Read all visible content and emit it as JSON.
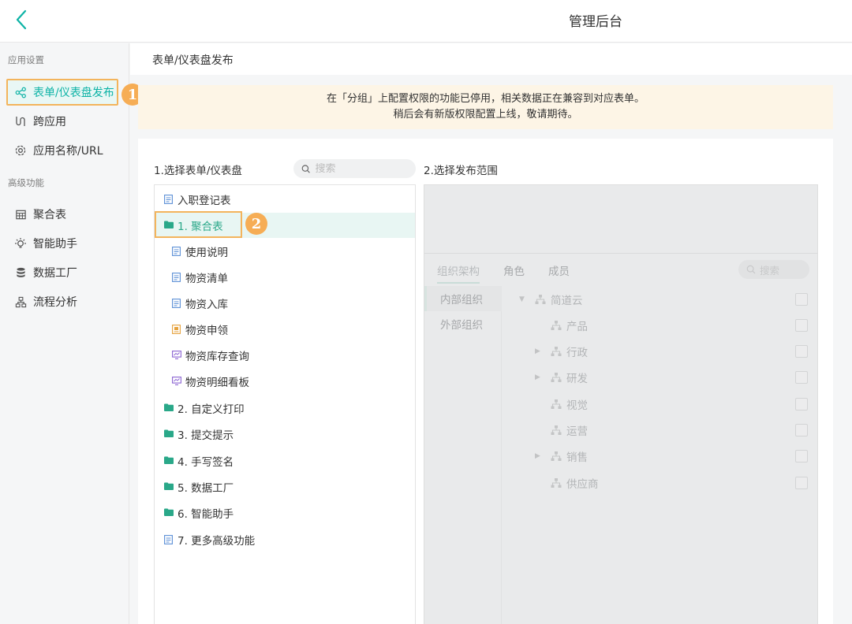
{
  "header": {
    "title": "管理后台",
    "back_icon": "chevron-left-icon"
  },
  "sidebar": {
    "sections": [
      {
        "label": "应用设置"
      },
      {
        "label": "高级功能"
      }
    ],
    "items": [
      {
        "label": "表单/仪表盘发布",
        "icon": "share-icon",
        "active": true
      },
      {
        "label": "跨应用",
        "icon": "link-icon"
      },
      {
        "label": "应用名称/URL",
        "icon": "gear-icon"
      },
      {
        "label": "聚合表",
        "icon": "table-icon"
      },
      {
        "label": "智能助手",
        "icon": "bulb-icon"
      },
      {
        "label": "数据工厂",
        "icon": "database-icon"
      },
      {
        "label": "流程分析",
        "icon": "flow-icon"
      }
    ]
  },
  "annotations": {
    "badge1": "1",
    "badge2": "2"
  },
  "main": {
    "title": "表单/仪表盘发布",
    "notice": {
      "line1": "在「分组」上配置权限的功能已停用，相关数据正在兼容到对应表单。",
      "line2": "稍后会有新版权限配置上线，敬请期待。"
    },
    "left": {
      "title": "1.选择表单/仪表盘",
      "search_placeholder": "搜索",
      "tree": [
        {
          "label": "入职登记表",
          "type": "form",
          "level": 0
        },
        {
          "label": "1. 聚合表",
          "type": "folder",
          "level": 0,
          "selected": true
        },
        {
          "label": "使用说明",
          "type": "form",
          "level": 1
        },
        {
          "label": "物资清单",
          "type": "form",
          "level": 1
        },
        {
          "label": "物资入库",
          "type": "form",
          "level": 1
        },
        {
          "label": "物资申领",
          "type": "flow",
          "level": 1
        },
        {
          "label": "物资库存查询",
          "type": "dashboard",
          "level": 1
        },
        {
          "label": "物资明细看板",
          "type": "dashboard",
          "level": 1
        },
        {
          "label": "2. 自定义打印",
          "type": "folder",
          "level": 0
        },
        {
          "label": "3. 提交提示",
          "type": "folder",
          "level": 0
        },
        {
          "label": "4. 手写签名",
          "type": "folder",
          "level": 0
        },
        {
          "label": "5. 数据工厂",
          "type": "folder",
          "level": 0
        },
        {
          "label": "6. 智能助手",
          "type": "folder",
          "level": 0
        },
        {
          "label": "7. 更多高级功能",
          "type": "form",
          "level": 0
        }
      ]
    },
    "right": {
      "title": "2.选择发布范围",
      "tabs": [
        {
          "label": "组织架构",
          "active": true
        },
        {
          "label": "角色"
        },
        {
          "label": "成员"
        }
      ],
      "search_placeholder": "搜索",
      "left_items": [
        {
          "label": "内部组织",
          "active": true
        },
        {
          "label": "外部组织"
        }
      ],
      "org_tree": [
        {
          "label": "简道云",
          "level": 0,
          "expandable": true,
          "expanded": true
        },
        {
          "label": "产品",
          "level": 1,
          "expandable": false
        },
        {
          "label": "行政",
          "level": 1,
          "expandable": true
        },
        {
          "label": "研发",
          "level": 1,
          "expandable": true
        },
        {
          "label": "视觉",
          "level": 1,
          "expandable": false
        },
        {
          "label": "运营",
          "level": 1,
          "expandable": false
        },
        {
          "label": "销售",
          "level": 1,
          "expandable": true
        },
        {
          "label": "供应商",
          "level": 1,
          "expandable": false
        }
      ]
    }
  },
  "colors": {
    "accent": "#0db3a6",
    "highlight": "#f6ad55",
    "notice_bg": "#fdf5e6"
  }
}
